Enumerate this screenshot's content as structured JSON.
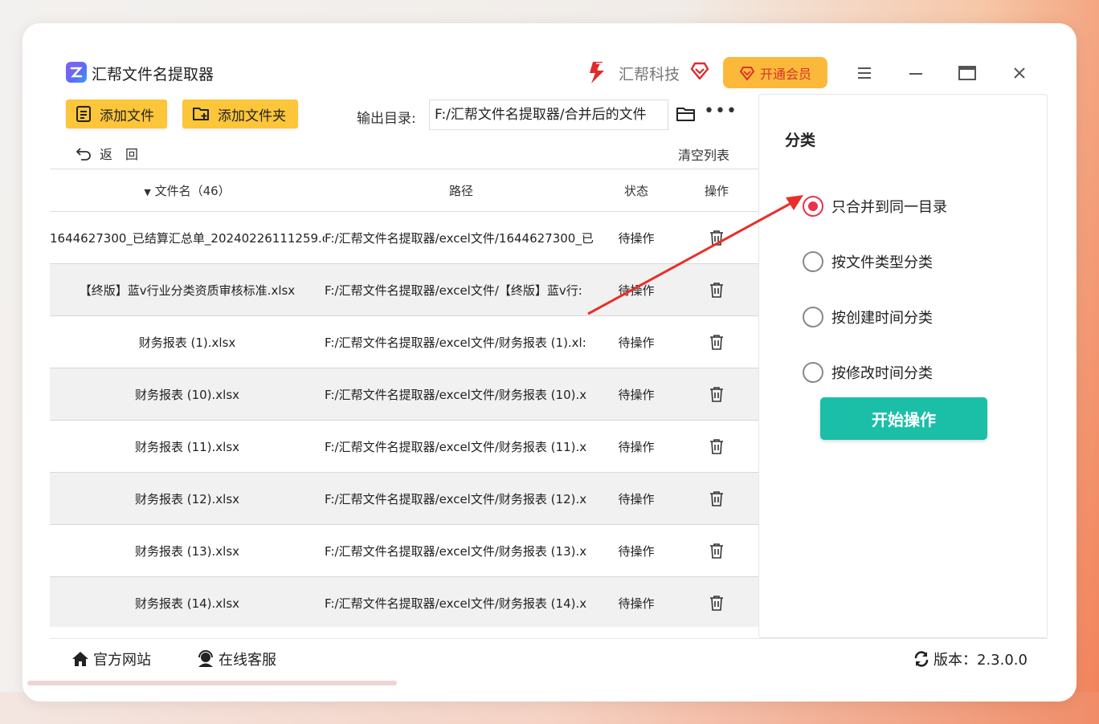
{
  "app": {
    "title": "汇帮文件名提取器",
    "brand_name": "汇帮科技",
    "vip_label": "开通会员"
  },
  "toolbar": {
    "add_file": "添加文件",
    "add_folder": "添加文件夹",
    "output_label": "输出目录:",
    "output_value": "F:/汇帮文件名提取器/合并后的文件",
    "back_label": "返　回",
    "clear_label": "清空列表"
  },
  "table": {
    "headers": {
      "name": "文件名（46）",
      "path": "路径",
      "status": "状态",
      "op": "操作"
    },
    "rows": [
      {
        "name": "1644627300_已结算汇总单_20240226111259.c",
        "path": "F:/汇帮文件名提取器/excel文件/1644627300_已",
        "status": "待操作"
      },
      {
        "name": "【终版】蓝v行业分类资质审核标准.xlsx",
        "path": "F:/汇帮文件名提取器/excel文件/【终版】蓝v行:",
        "status": "待操作"
      },
      {
        "name": "财务报表 (1).xlsx",
        "path": "F:/汇帮文件名提取器/excel文件/财务报表 (1).xl:",
        "status": "待操作"
      },
      {
        "name": "财务报表 (10).xlsx",
        "path": "F:/汇帮文件名提取器/excel文件/财务报表 (10).x",
        "status": "待操作"
      },
      {
        "name": "财务报表 (11).xlsx",
        "path": "F:/汇帮文件名提取器/excel文件/财务报表 (11).x",
        "status": "待操作"
      },
      {
        "name": "财务报表 (12).xlsx",
        "path": "F:/汇帮文件名提取器/excel文件/财务报表 (12).x",
        "status": "待操作"
      },
      {
        "name": "财务报表 (13).xlsx",
        "path": "F:/汇帮文件名提取器/excel文件/财务报表 (13).x",
        "status": "待操作"
      },
      {
        "name": "财务报表 (14).xlsx",
        "path": "F:/汇帮文件名提取器/excel文件/财务报表 (14).x",
        "status": "待操作"
      }
    ]
  },
  "side": {
    "title": "分类",
    "options": [
      {
        "label": "只合并到同一目录",
        "selected": true
      },
      {
        "label": "按文件类型分类",
        "selected": false
      },
      {
        "label": "按创建时间分类",
        "selected": false
      },
      {
        "label": "按修改时间分类",
        "selected": false
      }
    ],
    "start_label": "开始操作"
  },
  "footer": {
    "website": "官方网站",
    "service": "在线客服",
    "version": "版本：2.3.0.0"
  },
  "colors": {
    "accent_yellow": "#fcc53a",
    "start_green": "#1bbfa8",
    "radio_red": "#e8334a",
    "annotation_arrow": "#e8302a"
  }
}
